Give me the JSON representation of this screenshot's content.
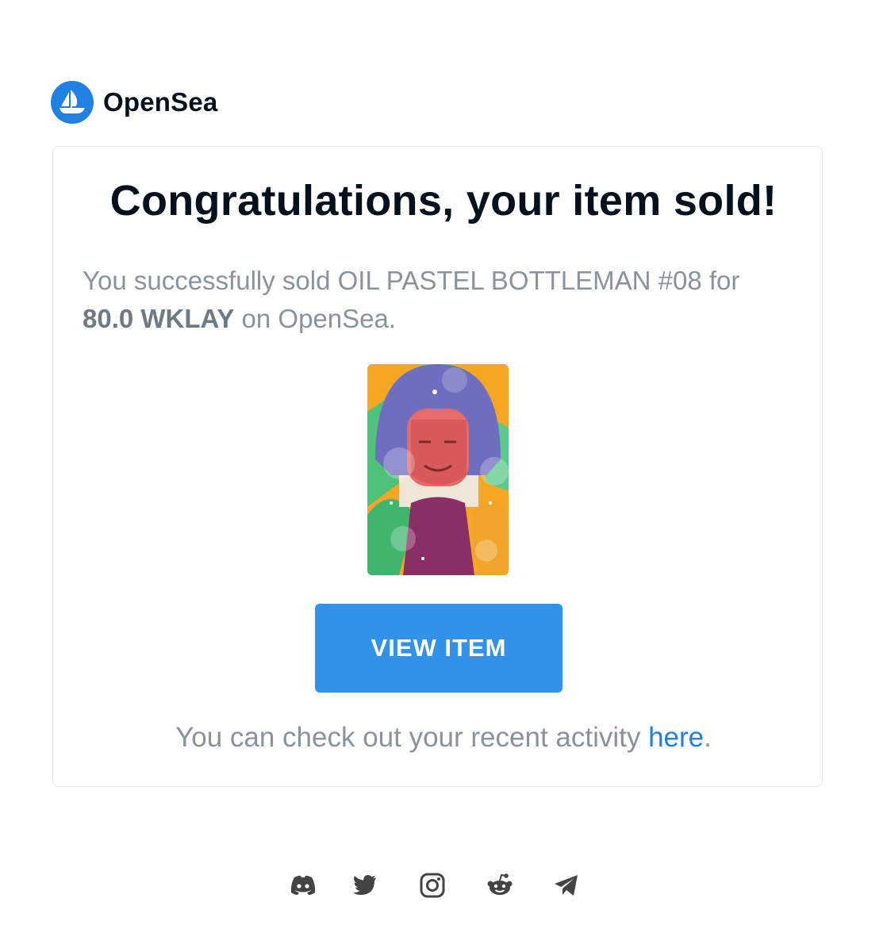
{
  "brand": {
    "name": "OpenSea",
    "logo_icon": "opensea-boat-icon",
    "color": "#2081e2"
  },
  "email": {
    "headline": "Congratulations, your item sold!",
    "message": {
      "prefix": "You successfully sold OIL PASTEL BOTTLEMAN #08 for ",
      "amount": "80.0 WKLAY",
      "suffix": " on OpenSea."
    },
    "item_image": {
      "alt": "OIL PASTEL BOTTLEMAN #08 artwork",
      "icon": "nft-artwork-image"
    },
    "button": {
      "label": "VIEW ITEM",
      "color": "#3291e9"
    },
    "activity": {
      "prefix": "You can check out your recent activity ",
      "link": "here",
      "suffix": "."
    }
  },
  "footer": {
    "socials": [
      "discord-icon",
      "twitter-icon",
      "instagram-icon",
      "reddit-icon",
      "telegram-icon"
    ],
    "icon_color": "#444444"
  }
}
